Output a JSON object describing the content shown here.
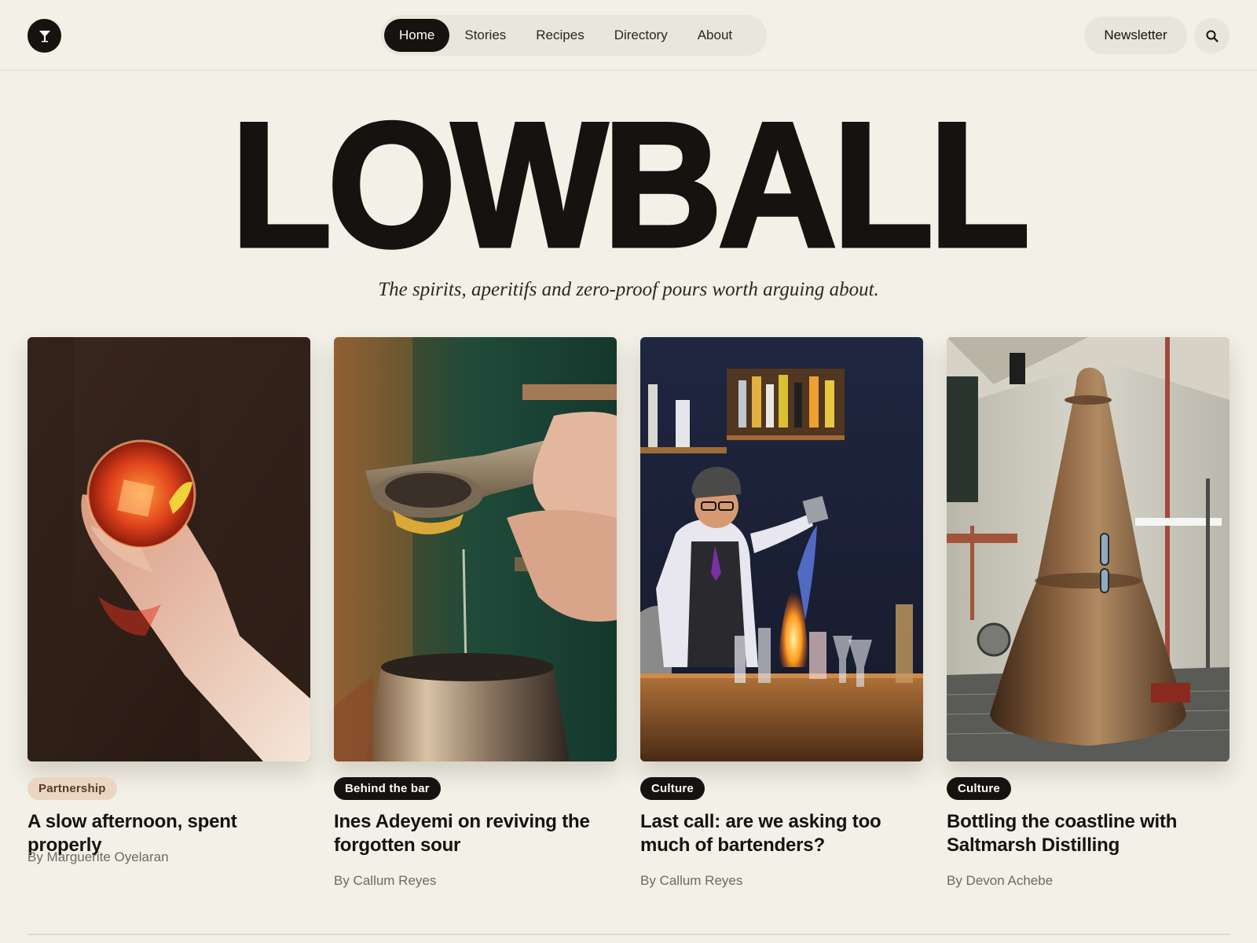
{
  "brand": {
    "logo_icon": "cocktail-glass-icon",
    "name": "LOWBALL"
  },
  "nav": {
    "items": [
      {
        "label": "Home",
        "active": true
      },
      {
        "label": "Stories",
        "active": false
      },
      {
        "label": "Recipes",
        "active": false
      },
      {
        "label": "Directory",
        "active": false
      },
      {
        "label": "About",
        "active": false
      }
    ]
  },
  "header": {
    "newsletter_label": "Newsletter",
    "search_icon": "search-icon"
  },
  "masthead": {
    "title": "LOWBALL",
    "tagline": "The spirits, aperitifs and zero-proof pours worth arguing about."
  },
  "cards": [
    {
      "tag": "Partnership",
      "tag_style": "light",
      "title": "A slow afternoon, spent properly",
      "author": "By Marguerite Oyelaran",
      "image": "hand holding negroni glass with orange twist"
    },
    {
      "tag": "Behind the bar",
      "tag_style": "dark",
      "title": "Ines Adeyemi on reviving the forgotten sour",
      "author": "By Callum Reyes",
      "image": "citrus press squeezing lemon into shaker tin"
    },
    {
      "tag": "Culture",
      "tag_style": "dark",
      "title": "Last call: are we asking too much of bartenders?",
      "author": "By Callum Reyes",
      "image": "bartender pouring flaming drink at bar"
    },
    {
      "tag": "Culture",
      "tag_style": "dark",
      "title": "Bottling the coastline with Saltmarsh Distilling",
      "author": "By Devon Achebe",
      "image": "copper pot still in distillery"
    }
  ],
  "colors": {
    "background": "#f2f0e7",
    "ink": "#15120f",
    "tag_light_bg": "#ead6c2",
    "muted_text": "#6f6a62"
  }
}
